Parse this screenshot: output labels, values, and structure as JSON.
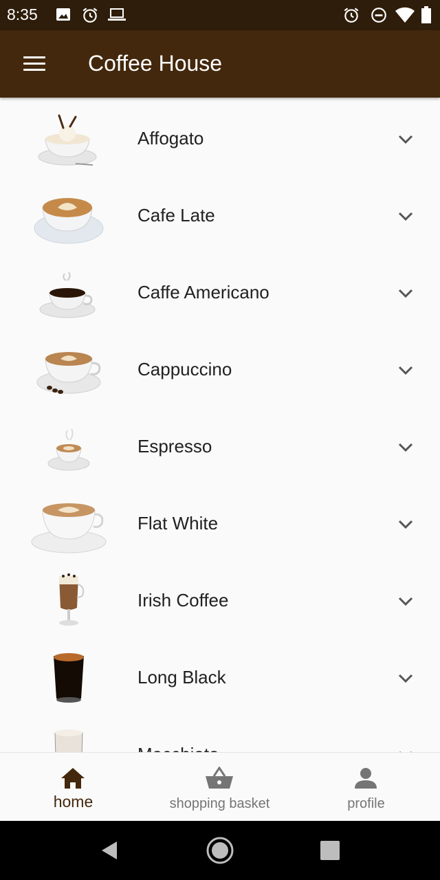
{
  "status_bar": {
    "time": "8:35",
    "left_icons": [
      "image-icon",
      "alarm-icon",
      "laptop-icon"
    ],
    "right_icons": [
      "alarm-icon",
      "do-not-disturb-icon",
      "wifi-icon",
      "battery-icon"
    ]
  },
  "app_bar": {
    "title": "Coffee House",
    "menu_icon": "hamburger-menu-icon"
  },
  "colors": {
    "primary": "#43280d",
    "status_bar": "#2e1d0a",
    "background": "#fafafa",
    "text": "#212121",
    "inactive": "#757575"
  },
  "menu": {
    "items": [
      {
        "label": "Affogato",
        "image": "affogato-image"
      },
      {
        "label": "Cafe Late",
        "image": "cafe-latte-image"
      },
      {
        "label": "Caffe Americano",
        "image": "caffe-americano-image"
      },
      {
        "label": "Cappuccino",
        "image": "cappuccino-image"
      },
      {
        "label": "Espresso",
        "image": "espresso-image"
      },
      {
        "label": "Flat White",
        "image": "flat-white-image"
      },
      {
        "label": "Irish Coffee",
        "image": "irish-coffee-image"
      },
      {
        "label": "Long Black",
        "image": "long-black-image"
      },
      {
        "label": "Macchiato",
        "image": "macchiato-image"
      }
    ],
    "expand_icon": "chevron-down-icon"
  },
  "bottom_nav": {
    "items": [
      {
        "label": "home",
        "icon": "home-icon",
        "active": true
      },
      {
        "label": "shopping basket",
        "icon": "shopping-basket-icon",
        "active": false
      },
      {
        "label": "profile",
        "icon": "person-icon",
        "active": false
      }
    ]
  },
  "system_nav": [
    "back-icon",
    "home-circle-icon",
    "recents-icon"
  ]
}
